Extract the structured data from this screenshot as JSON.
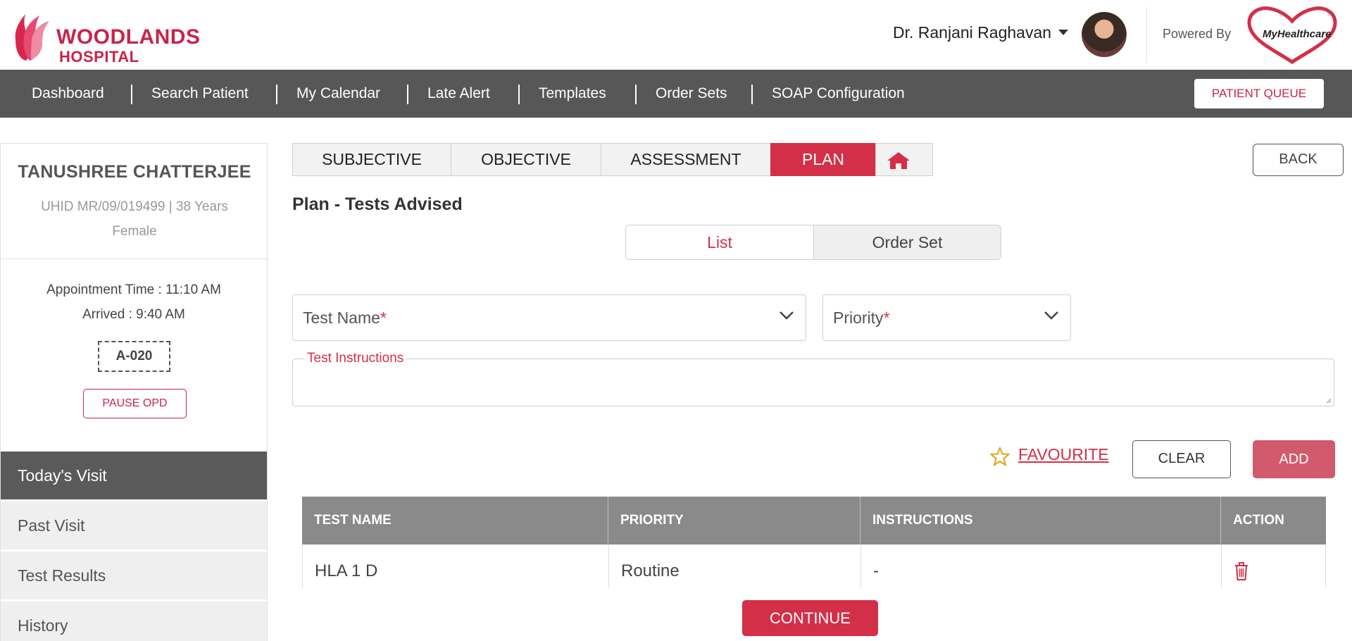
{
  "header": {
    "logo_line1": "WOODLANDS",
    "logo_line2": "HOSPITAL",
    "user_name": "Dr. Ranjani Raghavan",
    "powered_by": "Powered By",
    "partner_logo_text": "MyHealthcare"
  },
  "nav": {
    "items": [
      "Dashboard",
      "Search Patient",
      "My Calendar",
      "Late Alert",
      "Templates",
      "Order Sets",
      "SOAP Configuration"
    ],
    "queue_button": "PATIENT QUEUE"
  },
  "patient": {
    "name": "TANUSHREE CHATTERJEE",
    "uhid_line": "UHID MR/09/019499 | 38 Years",
    "gender": "Female",
    "appointment": "Appointment Time : 11:10 AM",
    "arrived": "Arrived : 9:40 AM",
    "token": "A-020",
    "pause_button": "PAUSE OPD"
  },
  "sidebar": {
    "items": [
      "Today's Visit",
      "Past Visit",
      "Test Results",
      "History"
    ],
    "active": "Today's Visit"
  },
  "tabs": {
    "items": [
      "SUBJECTIVE",
      "OBJECTIVE",
      "ASSESSMENT",
      "PLAN"
    ],
    "active": "PLAN",
    "home_icon": "home-icon"
  },
  "back_button": "BACK",
  "section_title": "Plan - Tests Advised",
  "toggle": {
    "list": "List",
    "order_set": "Order Set",
    "selected": "List"
  },
  "form": {
    "test_name_label": "Test Name",
    "priority_label": "Priority",
    "required_mark": "*",
    "instructions_label": "Test Instructions",
    "instructions_value": ""
  },
  "actions": {
    "favourite": "FAVOURITE",
    "clear": "CLEAR",
    "add": "ADD"
  },
  "table": {
    "headers": [
      "TEST NAME",
      "PRIORITY",
      "INSTRUCTIONS",
      "ACTION"
    ],
    "rows": [
      {
        "test_name": "HLA 1 D",
        "priority": "Routine",
        "instructions": "-"
      }
    ]
  },
  "continue_button": "CONTINUE",
  "colors": {
    "brand": "#c8234b",
    "accent": "#d42f48",
    "nav_bg": "#575757"
  }
}
